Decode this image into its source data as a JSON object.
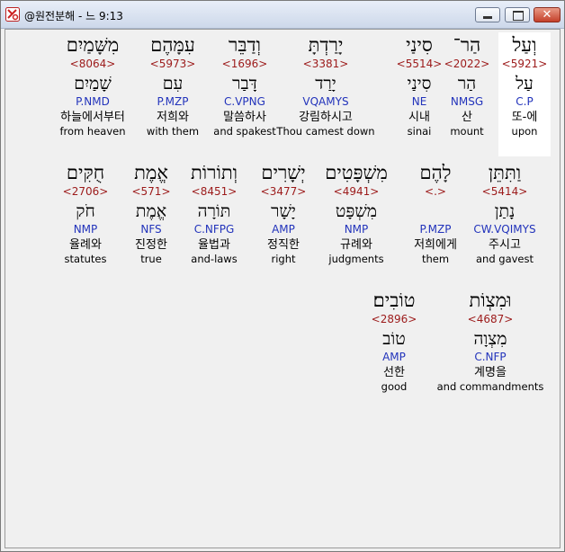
{
  "window": {
    "title": "@원전분해 - 느 9:13",
    "minimize_label": "",
    "maximize_label": "",
    "close_label": "✕"
  },
  "rows": [
    [
      {
        "heb": "וְעַל",
        "code": "<5921>",
        "lemma": "עַל",
        "morph": "C.P",
        "kor": "또-에",
        "eng": "upon"
      },
      {
        "heb": "הַר־",
        "code": "<2022>",
        "lemma": "הַר",
        "morph": "NMSG",
        "kor": "산",
        "eng": "mount"
      },
      {
        "heb": "סִינַי",
        "code": "<5514>",
        "lemma": "סִינַי",
        "morph": "NE",
        "kor": "시내",
        "eng": "sinai"
      },
      {
        "heb": "יָרַדְתָּ",
        "code": "<3381>",
        "lemma": "יָרַד",
        "morph": "VQAMYS",
        "kor": "강림하시고",
        "eng": "Thou camest down"
      },
      {
        "heb": "וְדַבֵּר",
        "code": "<1696>",
        "lemma": "דָּבַר",
        "morph": "C.VPNG",
        "kor": "말씀하사",
        "eng": "and spakest"
      },
      {
        "heb": "עִמָּהֶם",
        "code": "<5973>",
        "lemma": "עִם",
        "morph": "P.MZP",
        "kor": "저희와",
        "eng": "with them"
      },
      {
        "heb": "מִשָּׁמַיִם",
        "code": "<8064>",
        "lemma": "שָׁמַיִם",
        "morph": "P.NMD",
        "kor": "하늘에서부터",
        "eng": "from heaven"
      }
    ],
    [
      {
        "heb": "וַתִּתֵּן",
        "code": "<5414>",
        "lemma": "נָתַן",
        "morph": "CW.VQIMYS",
        "kor": "주시고",
        "eng": "and gavest"
      },
      {
        "heb": "לָהֶם",
        "code": "<.>",
        "lemma": "",
        "morph": "P.MZP",
        "kor": "저희에게",
        "eng": "them"
      },
      {
        "heb": "מִשְׁפָּטִים",
        "code": "<4941>",
        "lemma": "מִשְׁפָּט",
        "morph": "NMP",
        "kor": "규례와",
        "eng": "judgments"
      },
      {
        "heb": "יְשָׁרִים",
        "code": "<3477>",
        "lemma": "יָשָׁר",
        "morph": "AMP",
        "kor": "정직한",
        "eng": "right"
      },
      {
        "heb": "וְתוֹרוֹת",
        "code": "<8451>",
        "lemma": "תּוֹרָה",
        "morph": "C.NFPG",
        "kor": "율법과",
        "eng": "and-laws"
      },
      {
        "heb": "אֱמֶת",
        "code": "<571>",
        "lemma": "אֱמֶת",
        "morph": "NFS",
        "kor": "진정한",
        "eng": "true"
      },
      {
        "heb": "חֻקִּים",
        "code": "<2706>",
        "lemma": "חֹק",
        "morph": "NMP",
        "kor": "율례와",
        "eng": "statutes"
      }
    ],
    [
      {
        "heb": "וּמִצְוֹת",
        "code": "<4687>",
        "lemma": "מִצְוָה",
        "morph": "C.NFP",
        "kor": "계명을",
        "eng": "and commandments"
      },
      {
        "heb": "טוֹבִים׃",
        "code": "<2896>",
        "lemma": "טוֹב",
        "morph": "AMP",
        "kor": "선한",
        "eng": "good"
      }
    ]
  ]
}
